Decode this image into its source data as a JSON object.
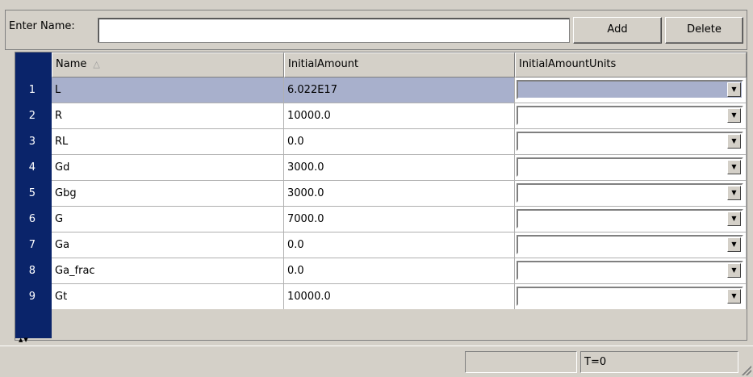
{
  "top": {
    "name_label": "Enter Name:",
    "name_value": "",
    "add_label": "Add",
    "delete_label": "Delete"
  },
  "table": {
    "columns": [
      "Name",
      "InitialAmount",
      "InitialAmountUnits"
    ],
    "sort_icon": "sort-ascending-icon",
    "rows": [
      {
        "num": "1",
        "name": "L",
        "amount": "6.022E17",
        "units": ""
      },
      {
        "num": "2",
        "name": "R",
        "amount": "10000.0",
        "units": ""
      },
      {
        "num": "3",
        "name": "RL",
        "amount": "0.0",
        "units": ""
      },
      {
        "num": "4",
        "name": "Gd",
        "amount": "3000.0",
        "units": ""
      },
      {
        "num": "5",
        "name": "Gbg",
        "amount": "3000.0",
        "units": ""
      },
      {
        "num": "6",
        "name": "G",
        "amount": "7000.0",
        "units": ""
      },
      {
        "num": "7",
        "name": "Ga",
        "amount": "0.0",
        "units": ""
      },
      {
        "num": "8",
        "name": "Ga_frac",
        "amount": "0.0",
        "units": ""
      },
      {
        "num": "9",
        "name": "Gt",
        "amount": "10000.0",
        "units": ""
      }
    ],
    "selected_row": 0
  },
  "status": {
    "left": "",
    "time": "T=0"
  },
  "colors": {
    "row_header": "#0a246a",
    "selection": "#a8b0cc",
    "chrome": "#d4d0c8"
  }
}
